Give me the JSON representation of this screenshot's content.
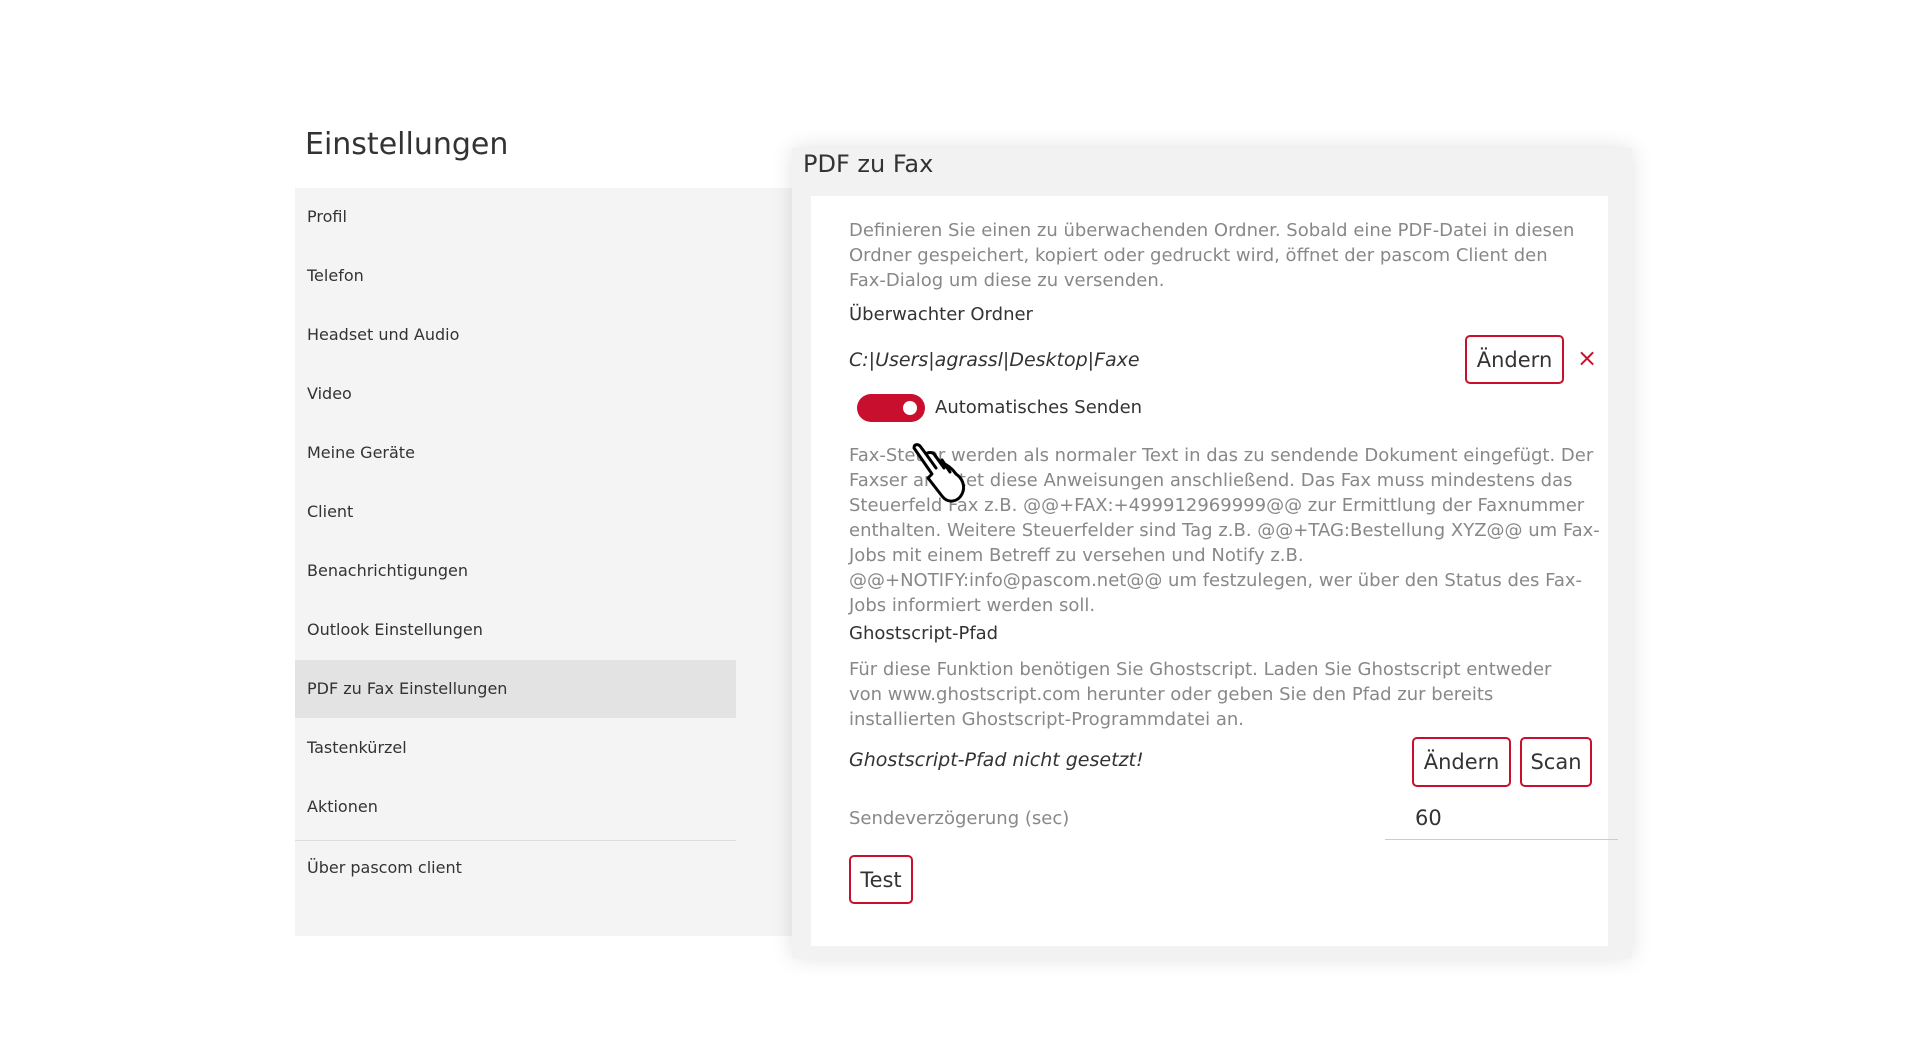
{
  "page": {
    "title": "Einstellungen"
  },
  "sidebar": {
    "items": [
      {
        "label": "Profil"
      },
      {
        "label": "Telefon"
      },
      {
        "label": "Headset und Audio"
      },
      {
        "label": "Video"
      },
      {
        "label": "Meine Geräte"
      },
      {
        "label": "Client"
      },
      {
        "label": "Benachrichtigungen"
      },
      {
        "label": "Outlook Einstellungen"
      },
      {
        "label": "PDF zu Fax Einstellungen",
        "active": true
      },
      {
        "label": "Tastenkürzel"
      },
      {
        "label": "Aktionen"
      },
      {
        "label": "Über pascom client"
      }
    ]
  },
  "dialog": {
    "title": "PDF zu Fax",
    "intro": "Definieren Sie einen zu überwachenden Ordner. Sobald eine PDF-Datei in diesen Ordner gespeichert, kopiert oder gedruckt wird, öffnet der pascom Client den Fax-Dialog um diese zu versenden.",
    "watched_folder": {
      "label": "Überwachter Ordner",
      "path": "C:|Users|agrassl|Desktop|Faxe",
      "change_label": "Ändern",
      "clear_icon": "×"
    },
    "auto_send": {
      "label": "Automatisches Senden",
      "enabled": true
    },
    "fax_control_text": "Fax-Steuer werden als normaler Text in das zu sendende Dokument eingefügt. Der Faxser arbeitet diese Anweisungen anschließend. Das Fax muss mindestens das Steuerfeld Fax z.B. @@+FAX:+499912969999@@ zur Ermittlung der Faxnummer enthalten. Weitere Steuerfelder sind Tag z.B. @@+TAG:Bestellung XYZ@@ um Fax-Jobs mit einem Betreff zu versehen und Notify z.B. @@+NOTIFY:info@pascom.net@@ um festzulegen, wer über den Status des Fax-Jobs informiert werden soll.",
    "ghostscript": {
      "label": "Ghostscript-Pfad",
      "text": "Für diese Funktion benötigen Sie Ghostscript. Laden Sie Ghostscript entweder von www.ghostscript.com herunter oder geben Sie den Pfad zur bereits installierten Ghostscript-Programmdatei an.",
      "status": "Ghostscript-Pfad nicht gesetzt!",
      "change_label": "Ändern",
      "scan_label": "Scan"
    },
    "send_delay": {
      "label": "Sendeverzögerung (sec)",
      "value": "60"
    },
    "test_label": "Test"
  },
  "colors": {
    "accent": "#c8102e",
    "sidebar_bg": "#f4f4f4",
    "sidebar_active_bg": "#e3e3e3",
    "dialog_bg": "#f2f2f2",
    "muted_text": "#888888"
  },
  "icons": {
    "clear": "close-icon",
    "cursor": "hand-pointer-icon"
  }
}
